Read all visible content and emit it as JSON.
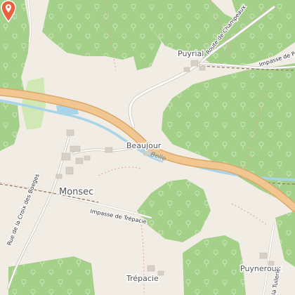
{
  "map": {
    "places": {
      "monsec": "Monsec",
      "beaujour": "Beaujour",
      "puyrial": "Puyrial",
      "trepacie": "Trépacie",
      "puyneroux": "Puyneroux"
    },
    "roads": {
      "route_champeaux": "Route de Champeaux",
      "impasse_puyrial": "Impasse de P",
      "rue_croix": "Rue de la Croix des Boeges",
      "impasse_trepacie": "Impasse de Trépacie",
      "tuilerie": "la Tuilerie"
    },
    "water": {
      "belle": "Belle"
    },
    "marker": {
      "icon": "location-pin-icon",
      "color": "#e8603c"
    },
    "colors": {
      "background": "#f1ede4",
      "forest": "#a4d08a",
      "meadow": "#cfe8b4",
      "river": "#a8d4ea",
      "main_road": "#f2c691"
    }
  }
}
